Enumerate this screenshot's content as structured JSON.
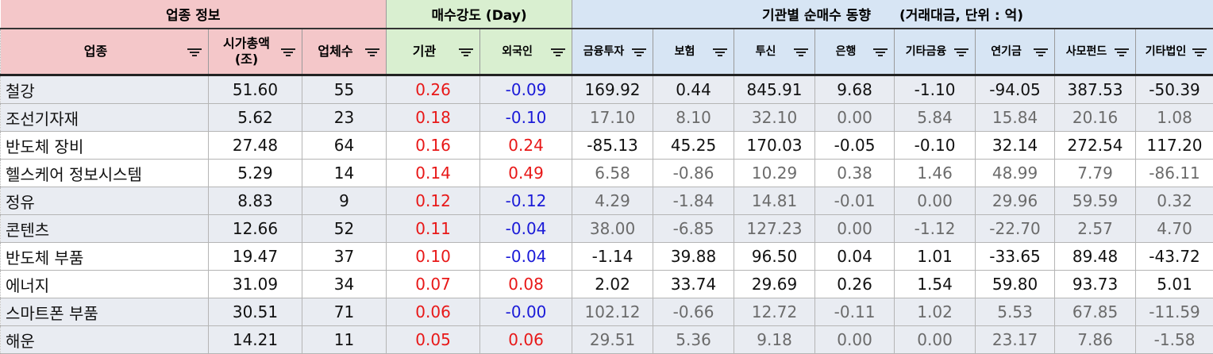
{
  "group_headers": {
    "sector_info": "업종 정보",
    "buy_strength": "매수강도 (Day)",
    "inst_flow_title": "기관별 순매수 동향",
    "inst_flow_unit": "(거래대금, 단위 : 억)"
  },
  "columns": {
    "sector": "업종",
    "market_cap_line1": "시가총액",
    "market_cap_line2": "(조)",
    "company_count": "업체수",
    "institution": "기관",
    "foreign": "외국인",
    "financial_investment": "금융투자",
    "insurance": "보험",
    "trust": "투신",
    "bank": "은행",
    "other_finance": "기타금융",
    "pension": "연기금",
    "private_fund": "사모펀드",
    "other_corp": "기타법인"
  },
  "colors": {
    "positive": "#e81818",
    "negative": "#1a1ad8",
    "sector_header_bg": "#f4c7c9",
    "strength_header_bg": "#d9efd0",
    "flow_header_bg": "#d7e5f4"
  },
  "rows": [
    {
      "sector": "철강",
      "cap": "51.60",
      "count": "55",
      "inst": "0.26",
      "foreign": "-0.09",
      "fin": "169.92",
      "ins": "0.44",
      "trust": "845.91",
      "bank": "9.68",
      "etc_fin": "-1.10",
      "pension": "-94.05",
      "pe": "387.53",
      "etc_corp": "-50.39"
    },
    {
      "sector": "조선기자재",
      "cap": "5.62",
      "count": "23",
      "inst": "0.18",
      "foreign": "-0.10",
      "fin": "17.10",
      "ins": "8.10",
      "trust": "32.10",
      "bank": "0.00",
      "etc_fin": "5.84",
      "pension": "15.84",
      "pe": "20.16",
      "etc_corp": "1.08"
    },
    {
      "sector": "반도체 장비",
      "cap": "27.48",
      "count": "64",
      "inst": "0.16",
      "foreign": "0.24",
      "fin": "-85.13",
      "ins": "45.25",
      "trust": "170.03",
      "bank": "-0.05",
      "etc_fin": "-0.10",
      "pension": "32.14",
      "pe": "272.54",
      "etc_corp": "117.20"
    },
    {
      "sector": "헬스케어 정보시스템",
      "cap": "5.29",
      "count": "14",
      "inst": "0.14",
      "foreign": "0.49",
      "fin": "6.58",
      "ins": "-0.86",
      "trust": "10.29",
      "bank": "0.38",
      "etc_fin": "1.46",
      "pension": "48.99",
      "pe": "7.79",
      "etc_corp": "-86.11"
    },
    {
      "sector": "정유",
      "cap": "8.83",
      "count": "9",
      "inst": "0.12",
      "foreign": "-0.12",
      "fin": "4.29",
      "ins": "-1.84",
      "trust": "14.81",
      "bank": "-0.01",
      "etc_fin": "0.00",
      "pension": "29.96",
      "pe": "59.59",
      "etc_corp": "0.32"
    },
    {
      "sector": "콘텐츠",
      "cap": "12.66",
      "count": "52",
      "inst": "0.11",
      "foreign": "-0.04",
      "fin": "38.00",
      "ins": "-6.85",
      "trust": "127.23",
      "bank": "0.00",
      "etc_fin": "-1.12",
      "pension": "-22.70",
      "pe": "2.57",
      "etc_corp": "4.70"
    },
    {
      "sector": "반도체 부품",
      "cap": "19.47",
      "count": "37",
      "inst": "0.10",
      "foreign": "-0.04",
      "fin": "-1.14",
      "ins": "39.88",
      "trust": "96.50",
      "bank": "0.04",
      "etc_fin": "1.01",
      "pension": "-33.65",
      "pe": "89.48",
      "etc_corp": "-43.72"
    },
    {
      "sector": "에너지",
      "cap": "31.09",
      "count": "34",
      "inst": "0.07",
      "foreign": "0.08",
      "fin": "2.02",
      "ins": "33.74",
      "trust": "29.69",
      "bank": "0.26",
      "etc_fin": "1.54",
      "pension": "59.80",
      "pe": "93.73",
      "etc_corp": "5.01"
    },
    {
      "sector": "스마트폰 부품",
      "cap": "30.51",
      "count": "71",
      "inst": "0.06",
      "foreign": "-0.00",
      "fin": "102.12",
      "ins": "-0.66",
      "trust": "12.72",
      "bank": "-0.11",
      "etc_fin": "1.02",
      "pension": "5.53",
      "pe": "67.85",
      "etc_corp": "-11.59"
    },
    {
      "sector": "해운",
      "cap": "14.21",
      "count": "11",
      "inst": "0.05",
      "foreign": "0.06",
      "fin": "29.51",
      "ins": "5.36",
      "trust": "9.18",
      "bank": "0.00",
      "etc_fin": "0.00",
      "pension": "23.17",
      "pe": "7.86",
      "etc_corp": "-1.58"
    }
  ]
}
